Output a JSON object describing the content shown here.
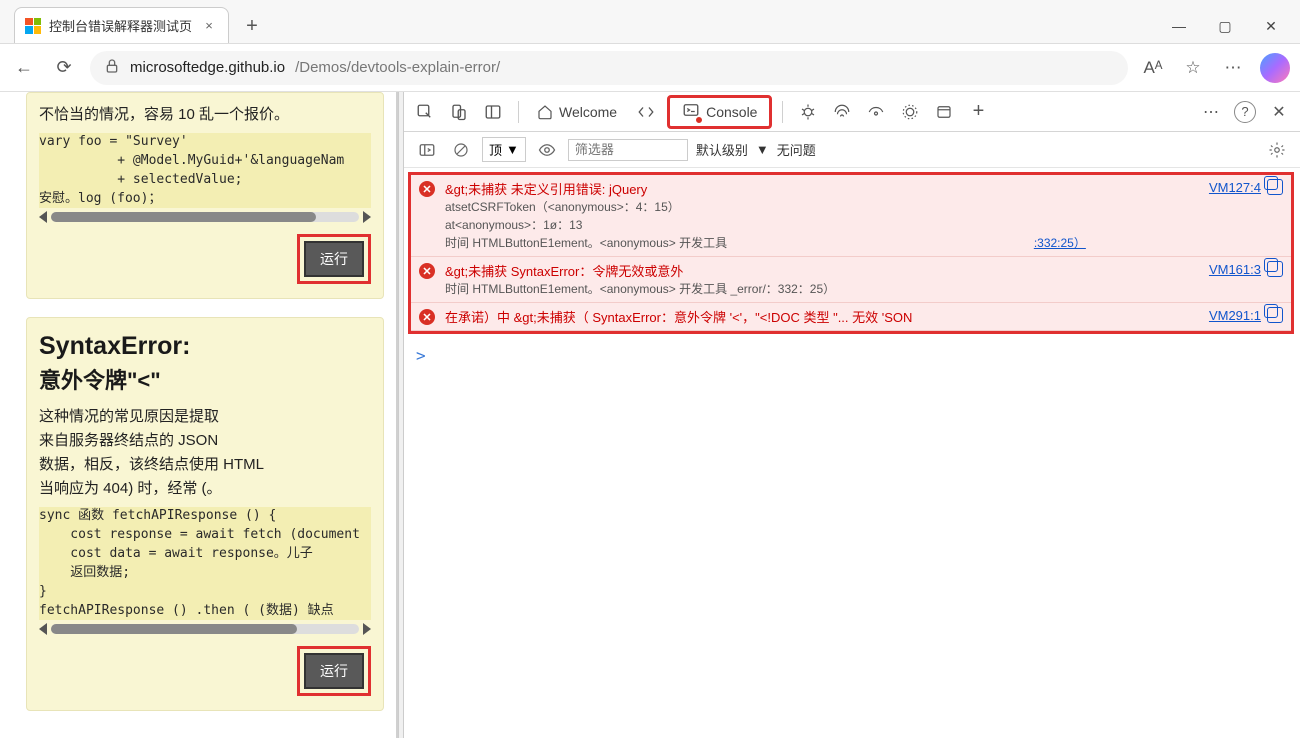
{
  "window": {
    "tab_title": "控制台错误解释器测试页",
    "close_glyph": "×",
    "newtab_glyph": "+",
    "minimize_glyph": "—",
    "maximize_glyph": "▢",
    "winclose_glyph": "✕"
  },
  "addressbar": {
    "back_glyph": "←",
    "refresh_glyph": "⟳",
    "lock_glyph": "🔒",
    "url_domain": "microsoftedge.github.io",
    "url_path": "/Demos/devtools-explain-error/",
    "read_aloud": "Aᴬ",
    "favorite": "☆",
    "more": "⋯"
  },
  "page": {
    "card1_intro": "不恰当的情况，容易 10 乱一个报价。",
    "card1_code": "vary foo = \"Survey'\n          + @Model.MyGuid+'&languageNam\n          + selectedValue;\n安慰。log (foo)；",
    "run_label": "运行",
    "card2_h2": "SyntaxError:",
    "card2_h3": "意外令牌\"<\"",
    "card2_para": "这种情况的常见原因是提取\n来自服务器终结点的 JSON\n数据，相反，该终结点使用   HTML\n当响应为 404) 时，经常 (。",
    "card2_code": "sync 函数 fetchAPIResponse () {\n    cost response = await fetch (document\n    cost data = await response。儿子\n    返回数据;\n}\nfetchAPIResponse () .then ( (数据) 缺点"
  },
  "devtools": {
    "welcome": "Welcome",
    "console": "Console",
    "filter_top": "顶",
    "filter_placeholder": "筛选器",
    "default_levels": "默认级别",
    "no_issues": "无问题",
    "more": "⋯",
    "help": "?",
    "close": "✕"
  },
  "console_errors": [
    {
      "head": "&gt;未捕获      未定义引用错误: jQuery",
      "link": "VM127:4",
      "stack": [
        "atsetCSRFToken（<anonymous>：4：15）",
        "at<anonymous>：1ø：13",
        "时间 HTMLButtonE1ement。<anonymous>  开发工具"
      ],
      "stack_link": ":332:25）"
    },
    {
      "head": "&gt;未捕获      SyntaxError：令牌无效或意外",
      "link": "VM161:3",
      "stack": [
        "时间 HTMLButtonE1ement。<anonymous>  开发工具                                                                 _error/：332：25）"
      ],
      "stack_link": ""
    },
    {
      "head": "在承诺）中 &gt;未捕获（           SyntaxError：意外令牌                              '<'，\"<!DOC 类型    \"... 无效 'SON",
      "link": "VM291:1",
      "stack": [],
      "stack_link": ""
    }
  ]
}
